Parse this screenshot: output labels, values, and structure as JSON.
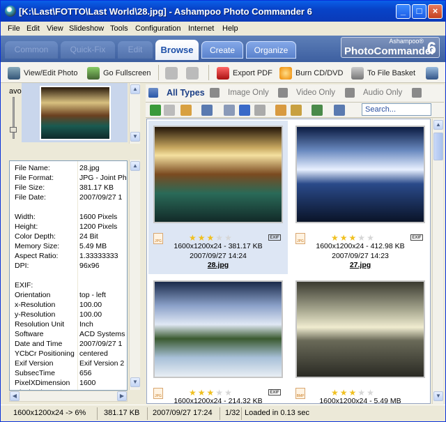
{
  "window": {
    "title": "[K:\\Last\\FOTTO\\Last World\\28.jpg] - Ashampoo Photo Commander 6",
    "minimize": "_",
    "maximize": "□",
    "close": "×"
  },
  "menu": [
    "File",
    "Edit",
    "View",
    "Slideshow",
    "Tools",
    "Configuration",
    "Internet",
    "Help"
  ],
  "tabs": [
    "Common",
    "Quick-Fix",
    "Edit",
    "Browse",
    "Create",
    "Organize"
  ],
  "brand": {
    "maker": "Ashampoo®",
    "name": "PhotoCommander",
    "version": "6"
  },
  "toolbar": {
    "view_edit": "View/Edit Photo",
    "fullscreen": "Go Fullscreen",
    "export_pdf": "Export PDF",
    "burn": "Burn CD/DVD",
    "basket": "To File Basket"
  },
  "left": {
    "favourites": "avourites",
    "dropdown": "▾",
    "info": [
      {
        "k": "File Name:",
        "v": "28.jpg"
      },
      {
        "k": "File Format:",
        "v": "JPG - Joint Ph"
      },
      {
        "k": "File Size:",
        "v": "381.17 KB"
      },
      {
        "k": "File Date:",
        "v": "2007/09/27 1"
      },
      {
        "k": "",
        "v": ""
      },
      {
        "k": "Width:",
        "v": "1600 Pixels"
      },
      {
        "k": "Height:",
        "v": "1200 Pixels"
      },
      {
        "k": "Color Depth:",
        "v": "24 Bit"
      },
      {
        "k": "Memory Size:",
        "v": "5.49 MB"
      },
      {
        "k": "Aspect Ratio:",
        "v": "1.33333333"
      },
      {
        "k": "DPI:",
        "v": "96x96"
      },
      {
        "k": "",
        "v": ""
      },
      {
        "k": "EXIF:",
        "v": ""
      },
      {
        "k": "Orientation",
        "v": "top - left"
      },
      {
        "k": "x-Resolution",
        "v": "100.00"
      },
      {
        "k": "y-Resolution",
        "v": "100.00"
      },
      {
        "k": "Resolution Unit",
        "v": "Inch"
      },
      {
        "k": "Software",
        "v": "ACD Systems"
      },
      {
        "k": "Date and Time",
        "v": "2007/09/27 1"
      },
      {
        "k": "YCbCr Positioning",
        "v": "centered"
      },
      {
        "k": "Exif Version",
        "v": "Exif Version 2"
      },
      {
        "k": "SubsecTime",
        "v": "656"
      },
      {
        "k": "PixelXDimension",
        "v": "1600"
      },
      {
        "k": "PixelYDimension",
        "v": "1200"
      }
    ]
  },
  "filters": {
    "all": "All Types",
    "image": "Image Only",
    "video": "Video Only",
    "audio": "Audio Only"
  },
  "search": {
    "placeholder": "Search..."
  },
  "thumbs": [
    {
      "format": "JPG",
      "rating": 3,
      "dims": "1600x1200x24 - 381.17 KB",
      "date": "2007/09/27 14:24",
      "name": "28.jpg",
      "exif": "EXIF",
      "selected": true
    },
    {
      "format": "JPG",
      "rating": 3,
      "dims": "1600x1200x24 - 412.98 KB",
      "date": "2007/09/27 14:23",
      "name": "27.jpg",
      "exif": "EXIF",
      "selected": false
    },
    {
      "format": "JPG",
      "rating": 3,
      "dims": "1600x1200x24 - 214.32 KB",
      "date": "",
      "name": "",
      "exif": "EXIF",
      "selected": false
    },
    {
      "format": "BMP",
      "rating": 3,
      "dims": "1600x1200x24 - 5.49 MB",
      "date": "",
      "name": "",
      "exif": "",
      "selected": false
    }
  ],
  "status": {
    "zoom": "1600x1200x24 -> 6%",
    "size": "381.17 KB",
    "date": "2007/09/27 17:24",
    "count": "1/32",
    "loaded": "Loaded in 0.13 sec"
  }
}
